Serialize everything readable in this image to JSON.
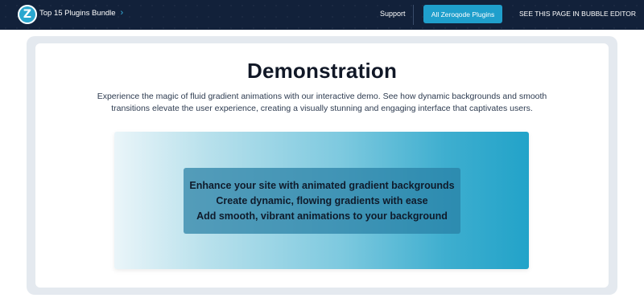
{
  "navbar": {
    "logo_letter": "Z",
    "bundle_label": "Top 15 Plugins Bundle",
    "bundle_chevron": "›",
    "support_label": "Support",
    "primary_button_label": "All Zeroqode Plugins",
    "editor_link_label": "SEE THIS PAGE IN BUBBLE EDITOR"
  },
  "main": {
    "title": "Demonstration",
    "description": "Experience the magic of fluid gradient animations with our interactive demo. See how dynamic backgrounds and smooth transitions elevate the user experience, creating a visually stunning and engaging interface that captivates users.",
    "demo_lines": [
      "Enhance your site with animated gradient backgrounds",
      "Create dynamic, flowing gradients with ease",
      "Add smooth, vibrant animations to your background"
    ]
  },
  "colors": {
    "navbar_bg": "#12213a",
    "accent": "#1f9fcc",
    "gradient_start": "#eaf5f9",
    "gradient_end": "#22a3c9"
  }
}
